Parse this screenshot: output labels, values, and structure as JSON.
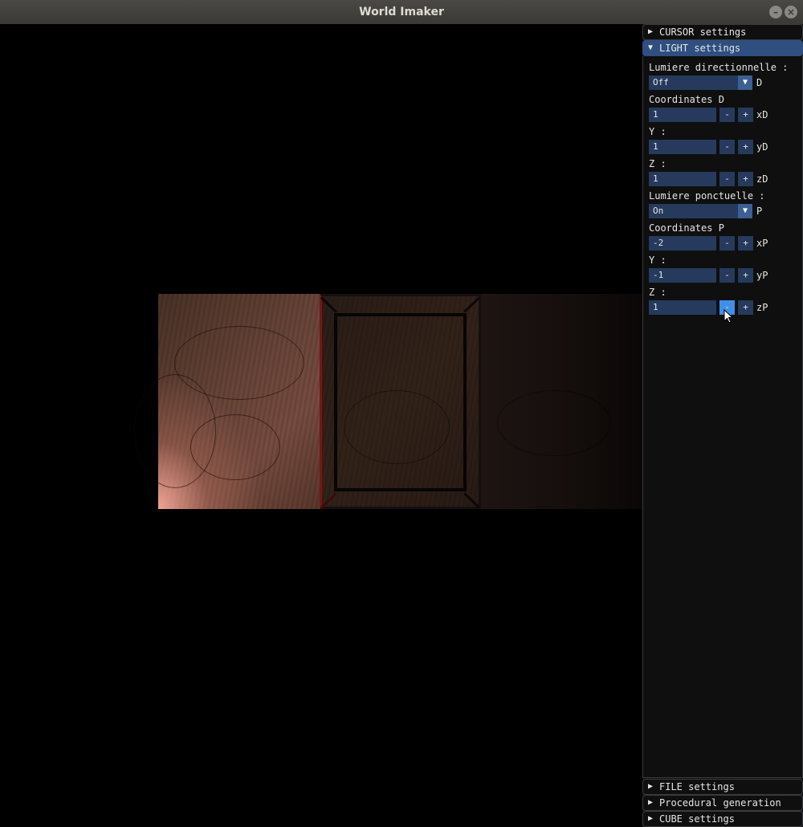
{
  "window": {
    "title": "World Imaker"
  },
  "panel": {
    "cursor_header": "CURSOR settings",
    "light_header": "LIGHT settings",
    "file_header": "FILE settings",
    "procedural_header": "Procedural generation",
    "cube_header": "CUBE settings",
    "light": {
      "directional_label": "Lumiere directionnelle :",
      "directional_value": "Off",
      "directional_suffix": "D",
      "coords_d_label": "Coordinates D",
      "xd_value": "1",
      "xd_suffix": "xD",
      "y_label_d": "Y :",
      "yd_value": "1",
      "yd_suffix": "yD",
      "z_label_d": "Z :",
      "zd_value": "1",
      "zd_suffix": "zD",
      "point_label": "Lumiere ponctuelle :",
      "point_value": "On",
      "point_suffix": "P",
      "coords_p_label": "Coordinates P",
      "xp_value": "-2",
      "xp_suffix": "xP",
      "y_label_p": "Y :",
      "yp_value": "-1",
      "yp_suffix": "yP",
      "z_label_p": "Z :",
      "zp_value": "1",
      "zp_suffix": "zP",
      "minus": "-",
      "plus": "+"
    },
    "icons": {
      "collapsed": "▶",
      "expanded": "▼",
      "dropdown": "▼"
    }
  },
  "colors": {
    "header_active": "#2f4f80",
    "frame_bg": "#253a5c",
    "button_hovered": "#3f8fe8"
  }
}
